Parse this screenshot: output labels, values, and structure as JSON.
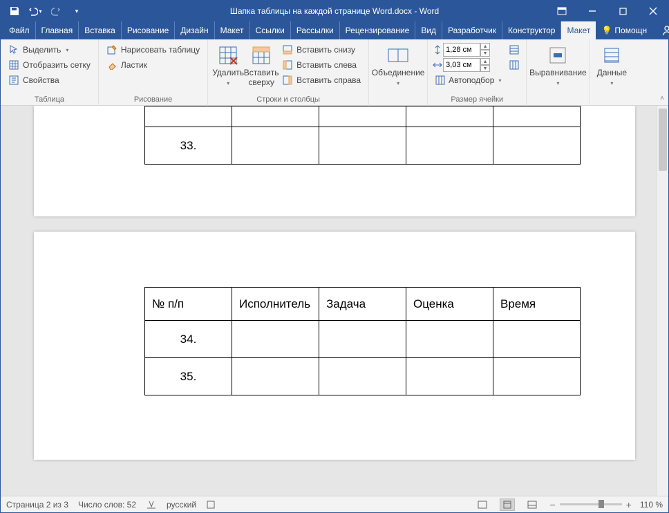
{
  "title": "Шапка таблицы на каждой странице Word.docx  -  Word",
  "qat": {
    "save": "save",
    "undo": "undo",
    "redo": "redo"
  },
  "tabs": [
    "Файл",
    "Главная",
    "Вставка",
    "Рисование",
    "Дизайн",
    "Макет",
    "Ссылки",
    "Рассылки",
    "Рецензирование",
    "Вид",
    "Разработчик",
    "Конструктор",
    "Макет"
  ],
  "active_tab_index": 12,
  "help_label": "Помощн",
  "ribbon": {
    "g1": {
      "label": "Таблица",
      "select": "Выделить",
      "gridlines": "Отобразить сетку",
      "properties": "Свойства"
    },
    "g2": {
      "label": "Рисование",
      "draw": "Нарисовать таблицу",
      "eraser": "Ластик"
    },
    "g3": {
      "label": "Строки и столбцы",
      "delete": "Удалить",
      "insert_above": "Вставить\nсверху",
      "insert_below": "Вставить снизу",
      "insert_left": "Вставить слева",
      "insert_right": "Вставить справа"
    },
    "g4": {
      "label": "Объединение",
      "merge": "Объединение"
    },
    "g5": {
      "label": "Размер ячейки",
      "height": "1,28 см",
      "width": "3,03 см",
      "autofit": "Автоподбор"
    },
    "g6": {
      "label": "Выравнивание",
      "align": "Выравнивание"
    },
    "g7": {
      "label": "Данные",
      "data": "Данные"
    }
  },
  "doc": {
    "page1_rows": [
      {
        "num": ""
      },
      {
        "num": "33."
      }
    ],
    "page2_header": [
      "№ п/п",
      "Исполнитель",
      "Задача",
      "Оценка",
      "Время"
    ],
    "page2_rows": [
      {
        "num": "34."
      },
      {
        "num": "35."
      }
    ]
  },
  "status": {
    "page": "Страница 2 из 3",
    "words": "Число слов: 52",
    "lang": "русский",
    "zoom": "110 %"
  }
}
